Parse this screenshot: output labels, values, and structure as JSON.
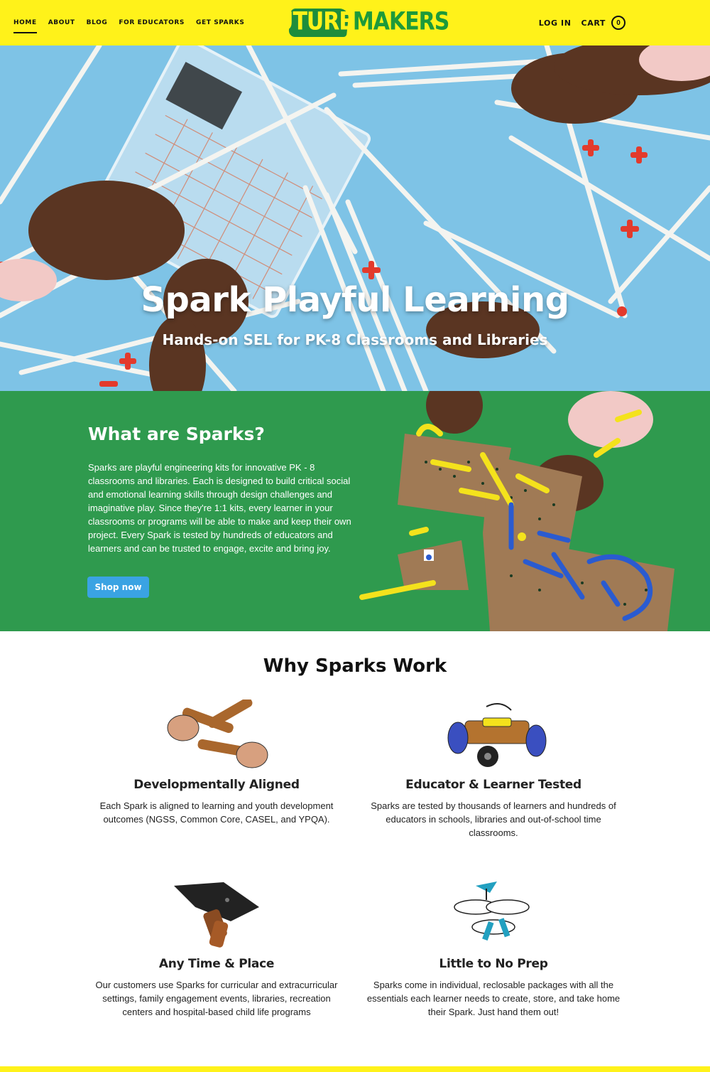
{
  "header": {
    "nav": [
      "HOME",
      "ABOUT",
      "BLOG",
      "FOR EDUCATORS",
      "GET SPARKS"
    ],
    "logo_part1": "FUTURE",
    "logo_part2": "MAKERS",
    "login": "LOG IN",
    "cart": "CART",
    "cart_count": "0"
  },
  "hero": {
    "title": "Spark Playful Learning",
    "subtitle": "Hands-on SEL for PK-8 Classrooms and Libraries"
  },
  "what": {
    "title": "What are Sparks?",
    "body": "Sparks are playful engineering kits for innovative PK - 8 classrooms and libraries. Each is designed to build critical social and emotional learning skills through design challenges and imaginative play. Since they're 1:1 kits, every learner in your classrooms or programs will be able to make and keep their own project. Every Spark is tested by hundreds of educators and learners and can be trusted to engage, excite and bring joy.",
    "button": "Shop now"
  },
  "why": {
    "title": "Why Sparks Work",
    "features": [
      {
        "title": "Developmentally Aligned",
        "text": "Each Spark is aligned to learning and youth development outcomes (NGSS, Common Core, CASEL, and YPQA)."
      },
      {
        "title": "Educator & Learner Tested",
        "text": "Sparks are tested by thousands of learners and hundreds of educators in schools, libraries and out-of-school time classrooms."
      },
      {
        "title": "Any Time & Place",
        "text": "Our customers use Sparks for curricular and extracurricular settings, family engagement events, libraries, recreation centers and hospital-based child life programs"
      },
      {
        "title": "Little to No Prep",
        "text": "Sparks come in individual, reclosable packages with all the essentials each learner needs to create, store, and take home their Spark.  Just hand them out!"
      }
    ]
  },
  "colors": {
    "header_yellow": "#fff21a",
    "hero_blue": "#7ec3e6",
    "section_green": "#2f9a4e",
    "button_blue": "#3aa3e3"
  }
}
